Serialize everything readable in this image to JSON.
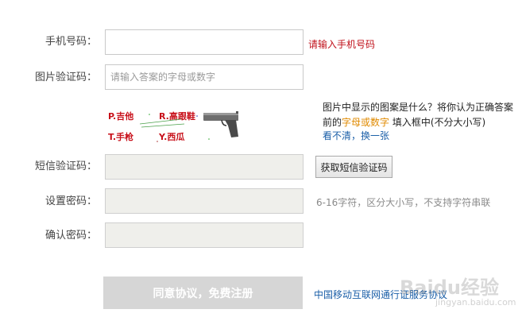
{
  "form": {
    "phone": {
      "label": "手机号码：",
      "value": "",
      "error": "请输入手机号码"
    },
    "captcha": {
      "label": "图片验证码：",
      "placeholder": "请输入答案的字母或数字"
    },
    "sms": {
      "label": "短信验证码：",
      "button": "获取短信验证码"
    },
    "password": {
      "label": "设置密码：",
      "hint": "6-16字符，区分大小写，不支持字符串联"
    },
    "confirm": {
      "label": "确认密码："
    }
  },
  "captcha_image": {
    "options": [
      "P.吉他",
      "R.高跟鞋",
      "T.手枪",
      "Y.西瓜"
    ],
    "icon": "pistol-icon"
  },
  "question": {
    "prefix": "图片中显示的图案是什么？将你认为正确答案前的",
    "highlight": "字母或数字",
    "suffix": "填入框中(不分大小写)",
    "refresh_link": "看不清，换一张"
  },
  "submit": {
    "label": "同意协议，免费注册"
  },
  "agreement_link": "中国移动互联网通行证服务协议",
  "watermark": {
    "brand": "Baidu经验",
    "sub": "jingyan.baidu.com"
  },
  "colors": {
    "error": "#c0101a",
    "link": "#1b5fa8",
    "highlight": "#e08a00",
    "disabled_btn": "#d6d6d6"
  }
}
